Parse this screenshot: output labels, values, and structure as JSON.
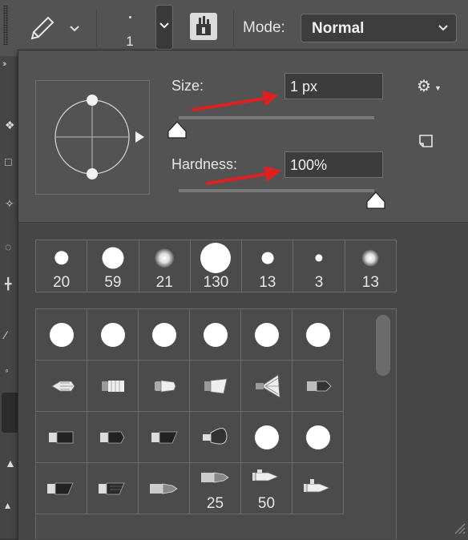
{
  "options_bar": {
    "tool_icon": "pencil-icon",
    "brush_size_preview": "1",
    "brush_settings_icon": "brush-settings-icon",
    "mode_label": "Mode:",
    "mode_value": "Normal"
  },
  "brush_picker": {
    "size_label": "Size:",
    "size_value": "1 px",
    "size_slider_fraction": 0.0,
    "hardness_label": "Hardness:",
    "hardness_value": "100%",
    "hardness_slider_fraction": 1.0,
    "annotation_arrow_color": "#e02020",
    "settings_icon": "gear-icon",
    "new_preset_icon": "new-preset-icon",
    "recent_brushes": [
      {
        "size": "20",
        "style": "hard"
      },
      {
        "size": "59",
        "style": "hard"
      },
      {
        "size": "21",
        "style": "soft"
      },
      {
        "size": "130",
        "style": "hard"
      },
      {
        "size": "13",
        "style": "hard"
      },
      {
        "size": "3",
        "style": "hard"
      },
      {
        "size": "13",
        "style": "soft"
      }
    ],
    "preset_rows": [
      [
        {
          "type": "round"
        },
        {
          "type": "round"
        },
        {
          "type": "round"
        },
        {
          "type": "round"
        },
        {
          "type": "round"
        },
        {
          "type": "round"
        }
      ],
      [
        {
          "type": "bristle-round"
        },
        {
          "type": "bristle-flat"
        },
        {
          "type": "bristle-round-2"
        },
        {
          "type": "bristle-fan-flat"
        },
        {
          "type": "bristle-fan"
        },
        {
          "type": "bristle-point"
        }
      ],
      [
        {
          "type": "bristle-blunt"
        },
        {
          "type": "bristle-blunt-2"
        },
        {
          "type": "bristle-angle"
        },
        {
          "type": "bristle-cat"
        },
        {
          "type": "round"
        },
        {
          "type": "round"
        }
      ],
      [
        {
          "type": "bristle-angle-2"
        },
        {
          "type": "bristle-angle-3"
        },
        {
          "type": "erodible-point"
        },
        {
          "type": "erodible-flat",
          "label": "25"
        },
        {
          "type": "airbrush",
          "label": "50"
        },
        {
          "type": "airbrush-2"
        }
      ]
    ]
  }
}
